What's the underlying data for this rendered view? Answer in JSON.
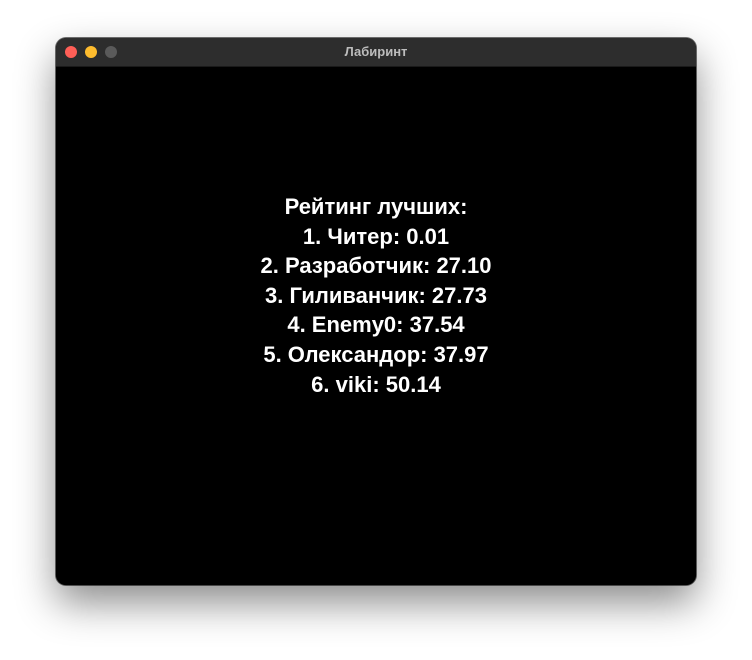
{
  "window": {
    "title": "Лабиринт",
    "controls": {
      "close": {
        "icon": "close-icon",
        "color": "#ff5f57"
      },
      "minimize": {
        "icon": "minimize-icon",
        "color": "#febc2e"
      },
      "zoom": {
        "icon": "zoom-icon",
        "color": "#5a5a5a"
      }
    },
    "background": "#000000"
  },
  "leaderboard": {
    "heading": "Рейтинг лучших:",
    "entries": [
      "1. Читер: 0.01",
      "2. Разработчик: 27.10",
      "3. Гиливанчик: 27.73",
      "4. Enemy0: 37.54",
      "5. Олександор: 37.97",
      "6. viki: 50.14"
    ],
    "text_color": "#ffffff"
  }
}
